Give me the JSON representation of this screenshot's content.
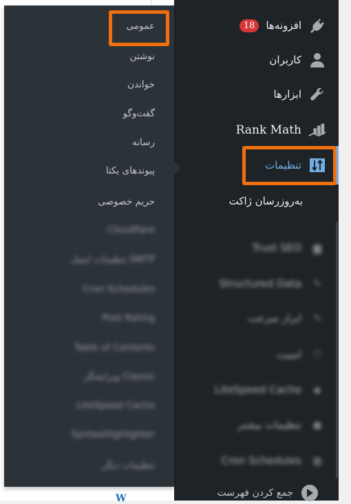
{
  "main_menu": {
    "items": [
      {
        "label": "افزونه‌ها",
        "icon": "plugin-icon",
        "badge": "18"
      },
      {
        "label": "کاربران",
        "icon": "user-icon"
      },
      {
        "label": "ابزارها",
        "icon": "wrench-icon"
      },
      {
        "label": "Rank Math",
        "icon": "rank-math-icon"
      },
      {
        "label": "تنظیمات",
        "icon": "settings-icon",
        "active": true
      },
      {
        "label": "به‌روزرسان ژاکت"
      }
    ],
    "blurred_items": [
      "Trust SEO",
      "Structured Data",
      "ابزار سرعت",
      "امنیت",
      "LiteSpeed Cache",
      "تنظیمات بیشتر",
      "Cron Schedules"
    ],
    "collapse_label": "جمع کردن فهرست"
  },
  "flyout": {
    "items": [
      "عمومی",
      "نوشتن",
      "خواندن",
      "گفت‌وگو",
      "رسانه",
      "پیوندهای یکتا",
      "حریم خصوصی"
    ],
    "blurred_items": [
      "Cloudflare",
      "SMTP تنظیمات ایمیل",
      "Cron Schedules",
      "Post Rating",
      "Table of Contents",
      "Classic ویرایشگر",
      "LiteSpeed Cache",
      "SyntaxHighlighter",
      "تنظیمات دیگر"
    ]
  },
  "colors": {
    "menu_bg": "#1d2327",
    "flyout_bg": "#2c3338",
    "active": "#72aee6",
    "highlight": "#f0700f",
    "badge": "#d63638"
  }
}
